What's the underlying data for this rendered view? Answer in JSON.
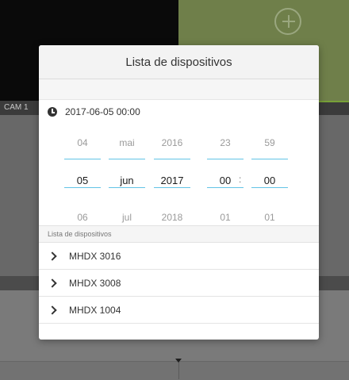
{
  "background": {
    "camera_label": "CAM 1"
  },
  "dialog": {
    "title": "Lista de dispositivos",
    "datetime": "2017-06-05 00:00",
    "picker": {
      "day": {
        "prev": "04",
        "current": "05",
        "next": "06"
      },
      "month": {
        "prev": "mai",
        "current": "jun",
        "next": "jul"
      },
      "year": {
        "prev": "2016",
        "current": "2017",
        "next": "2018"
      },
      "hour": {
        "prev": "23",
        "current": "00",
        "next": "01"
      },
      "minute": {
        "prev": "59",
        "current": "00",
        "next": "01"
      },
      "separator": ":"
    },
    "device_list": {
      "header": "Lista de dispositivos",
      "items": [
        {
          "label": "MHDX 3016"
        },
        {
          "label": "MHDX 3008"
        },
        {
          "label": "MHDX 1004"
        }
      ]
    }
  },
  "colors": {
    "accent_line": "#62c4e6",
    "status_green": "#77a038"
  }
}
